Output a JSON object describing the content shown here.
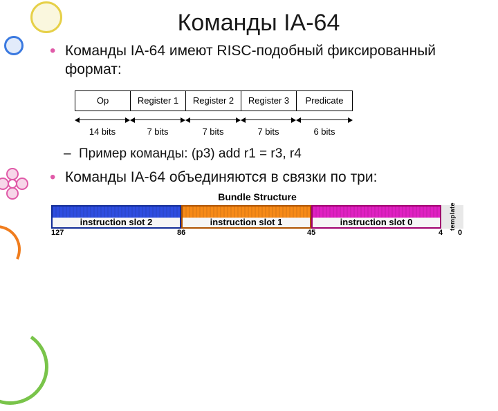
{
  "title": "Команды IA-64",
  "bullet1": "Команды IA-64 имеют RISC-подобный фиксированный формат:",
  "instr_format": {
    "cells": [
      "Op",
      "Register 1",
      "Register 2",
      "Register 3",
      "Predicate"
    ],
    "bits": [
      "14 bits",
      "7 bits",
      "7 bits",
      "7 bits",
      "6 bits"
    ]
  },
  "sub_bullet": "Пример команды: (p3) add r1 = r3, r4",
  "bullet2": "Команды IA-64 объединяются в связки по три:",
  "bundle": {
    "title": "Bundle Structure",
    "slots": [
      "instruction slot 2",
      "instruction slot 1",
      "instruction slot 0"
    ],
    "template_label": "template",
    "bits": {
      "left": "127",
      "m1": "86",
      "m2": "45",
      "r1": "4",
      "r2": "0"
    }
  }
}
